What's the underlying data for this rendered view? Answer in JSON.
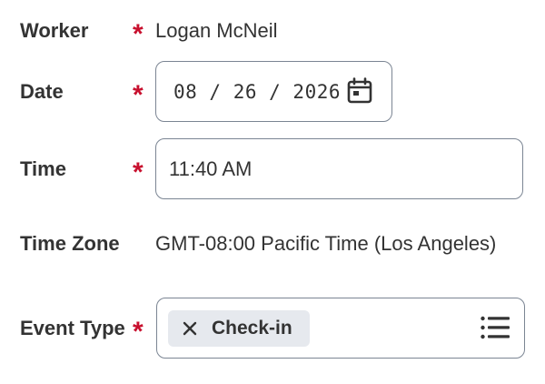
{
  "form": {
    "worker": {
      "label": "Worker",
      "required_mark": "*",
      "value": "Logan McNeil"
    },
    "date": {
      "label": "Date",
      "required_mark": "*",
      "value": "08 / 26 / 2026",
      "icon": "calendar-icon"
    },
    "time": {
      "label": "Time",
      "required_mark": "*",
      "value": "11:40 AM"
    },
    "time_zone": {
      "label": "Time Zone",
      "value": "GMT-08:00 Pacific Time (Los Angeles)"
    },
    "event_type": {
      "label": "Event Type",
      "required_mark": "*",
      "selected": "Check-in",
      "remove_icon": "close-icon",
      "list_icon": "list-icon"
    }
  },
  "colors": {
    "required": "#c8102e",
    "text": "#333333",
    "border": "#7b8593",
    "pill": "#e6e9ee"
  }
}
